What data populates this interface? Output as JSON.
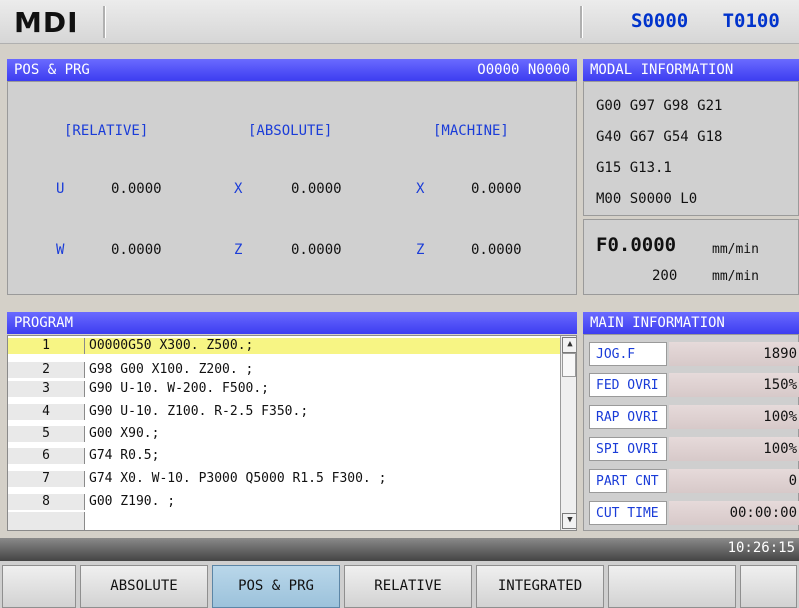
{
  "header": {
    "mode": "MDI",
    "spindle": "S0000",
    "tool": "T0100"
  },
  "pos_prg": {
    "title": "POS & PRG",
    "program_no": "O0000 N0000",
    "columns": [
      {
        "heading": "[RELATIVE]",
        "axes": [
          {
            "name": "U",
            "value": "0.0000"
          },
          {
            "name": "W",
            "value": "0.0000"
          }
        ]
      },
      {
        "heading": "[ABSOLUTE]",
        "axes": [
          {
            "name": "X",
            "value": "0.0000"
          },
          {
            "name": "Z",
            "value": "0.0000"
          }
        ]
      },
      {
        "heading": "[MACHINE]",
        "axes": [
          {
            "name": "X",
            "value": "0.0000"
          },
          {
            "name": "Z",
            "value": "0.0000"
          }
        ]
      }
    ]
  },
  "modal": {
    "title": "MODAL INFORMATION",
    "rows": [
      "G00 G97 G98 G21",
      "G40 G67 G54 G18",
      "G15 G13.1",
      "M00 S0000 L0"
    ],
    "feed": {
      "value": "F0.0000",
      "unit": "mm/min",
      "sub_value": "200",
      "sub_unit": "mm/min"
    }
  },
  "program": {
    "title": "PROGRAM",
    "lines": [
      {
        "num": "1",
        "text": "O0000G50 X300. Z500.;"
      },
      {
        "num": "2",
        "text": "G98 G00 X100. Z200. ;"
      },
      {
        "num": "3",
        "text": "G90 U-10. W-200. F500.;"
      },
      {
        "num": "4",
        "text": "G90 U-10. Z100. R-2.5 F350.;"
      },
      {
        "num": "5",
        "text": "G00 X90.;"
      },
      {
        "num": "6",
        "text": "G74 R0.5;"
      },
      {
        "num": "7",
        "text": "G74 X0. W-10. P3000 Q5000 R1.5 F300. ;"
      },
      {
        "num": "8",
        "text": "G00 Z190. ;"
      }
    ]
  },
  "main_info": {
    "title": "MAIN INFORMATION",
    "rows": [
      {
        "label": "JOG.F",
        "value": "1890"
      },
      {
        "label": "FED OVRI",
        "value": "150%"
      },
      {
        "label": "RAP OVRI",
        "value": "100%"
      },
      {
        "label": "SPI OVRI",
        "value": "100%"
      },
      {
        "label": "PART CNT",
        "value": "0"
      },
      {
        "label": "CUT TIME",
        "value": "00:00:00"
      }
    ]
  },
  "status": {
    "time": "10:26:15"
  },
  "softkeys": [
    "",
    "ABSOLUTE",
    "POS & PRG",
    "RELATIVE",
    "INTEGRATED",
    "",
    ""
  ],
  "active_softkey": "POS & PRG"
}
